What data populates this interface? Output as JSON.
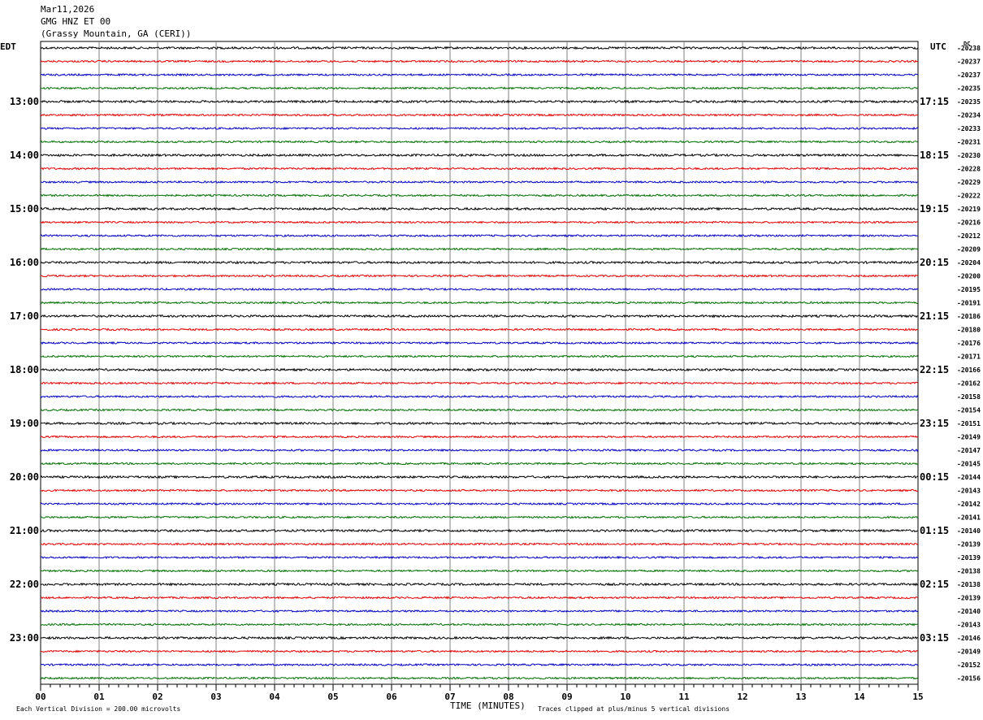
{
  "header": {
    "date": "Mar11,2026",
    "station": "GMG HNZ ET 00",
    "location": "(Grassy Mountain, GA (CERI))"
  },
  "chart_data": {
    "type": "line",
    "xlabel": "TIME (MINUTES)",
    "xlim": [
      0,
      15
    ],
    "x_ticks": [
      "00",
      "01",
      "02",
      "03",
      "04",
      "05",
      "06",
      "07",
      "08",
      "09",
      "10",
      "11",
      "12",
      "13",
      "14",
      "15"
    ],
    "left_axis_label": "EDT",
    "right_axis_label": "UTC",
    "dc_label": "DC",
    "left_time_labels": [
      "13:00",
      "14:00",
      "15:00",
      "16:00",
      "17:00",
      "18:00",
      "19:00",
      "20:00",
      "21:00",
      "22:00",
      "23:00"
    ],
    "right_time_labels": [
      "17:15",
      "18:15",
      "19:15",
      "20:15",
      "21:15",
      "22:15",
      "23:15",
      "00:15",
      "01:15",
      "02:15",
      "03:15"
    ],
    "trace_colors": [
      "#000000",
      "#e00000",
      "#0000c0",
      "#007000"
    ],
    "dc_offsets": [
      -20238,
      -20237,
      -20237,
      -20235,
      -20235,
      -20234,
      -20233,
      -20231,
      -20230,
      -20228,
      -20229,
      -20222,
      -20219,
      -20216,
      -20212,
      -20209,
      -20204,
      -20200,
      -20195,
      -20191,
      -20186,
      -20180,
      -20176,
      -20171,
      -20166,
      -20162,
      -20158,
      -20154,
      -20151,
      -20149,
      -20147,
      -20145,
      -20144,
      -20143,
      -20142,
      -20141,
      -20140,
      -20139,
      -20139,
      -20138,
      -20138,
      -20139,
      -20140,
      -20143,
      -20146,
      -20149,
      -20152,
      -20156
    ],
    "footer_left": "Each Vertical Division =  200.00 microvolts",
    "footer_right": "Traces clipped at plus/minus 5 vertical divisions",
    "grid": true
  }
}
